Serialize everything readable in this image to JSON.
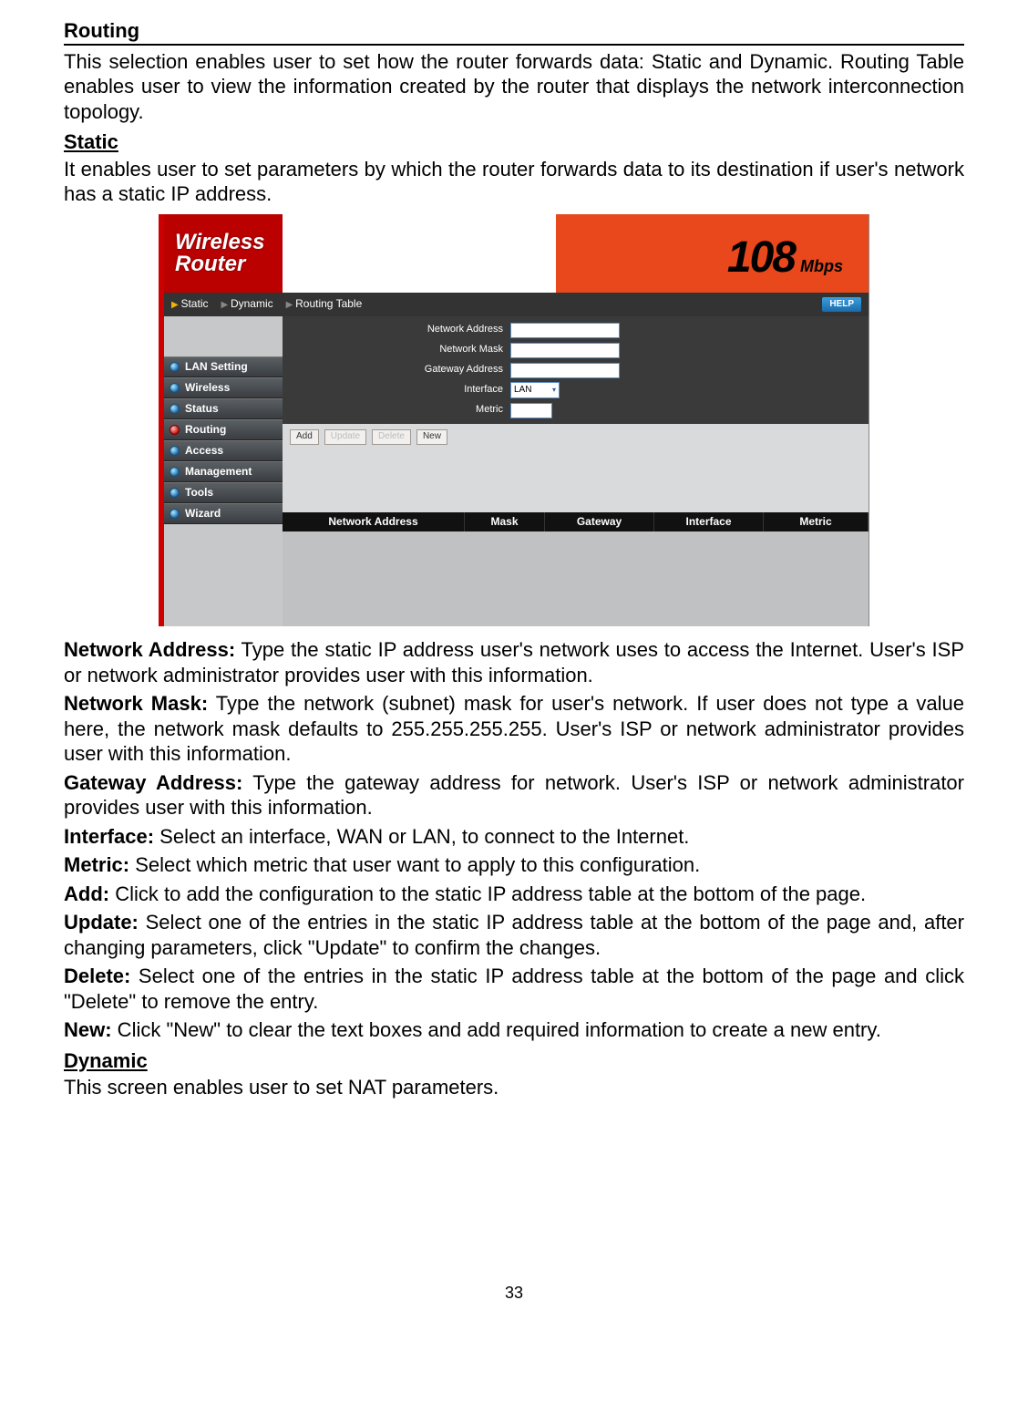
{
  "page_number": "33",
  "section": {
    "title": "Routing",
    "intro": "This selection enables user to set how the router forwards data: Static and Dynamic. Routing Table enables user to view the information created by the router that displays the network interconnection topology.",
    "static_title": "Static",
    "static_intro": "It enables user to set parameters by which the router forwards data to its destination if user's network has a static IP address.",
    "dynamic_title": "Dynamic",
    "dynamic_intro": "This screen enables user to set NAT parameters."
  },
  "router_ui": {
    "logo_line1": "Wireless",
    "logo_line2": "Router",
    "speed_number": "108",
    "speed_unit": "Mbps",
    "help_label": "HELP",
    "tabs": [
      "Static",
      "Dynamic",
      "Routing Table"
    ],
    "sidebar": [
      {
        "label": "LAN Setting",
        "active": false
      },
      {
        "label": "Wireless",
        "active": false
      },
      {
        "label": "Status",
        "active": false
      },
      {
        "label": "Routing",
        "active": true
      },
      {
        "label": "Access",
        "active": false
      },
      {
        "label": "Management",
        "active": false
      },
      {
        "label": "Tools",
        "active": false
      },
      {
        "label": "Wizard",
        "active": false
      }
    ],
    "form": {
      "network_address_label": "Network Address",
      "network_mask_label": "Network Mask",
      "gateway_address_label": "Gateway Address",
      "interface_label": "Interface",
      "interface_value": "LAN",
      "metric_label": "Metric"
    },
    "buttons": {
      "add": "Add",
      "update": "Update",
      "delete": "Delete",
      "new": "New"
    },
    "table_headers": [
      "Network Address",
      "Mask",
      "Gateway",
      "Interface",
      "Metric"
    ]
  },
  "descriptions": {
    "network_address_label": "Network Address:",
    "network_address_text": " Type the static IP address user's network uses to access the Internet. User's ISP or network administrator provides user with this information.",
    "network_mask_label": "Network Mask:",
    "network_mask_text": " Type the network (subnet) mask for user's network. If user does not type a value here, the network mask defaults to 255.255.255.255. User's ISP or network administrator provides user with this information.",
    "gateway_address_label": "Gateway Address:",
    "gateway_address_text": " Type the gateway address for network. User's ISP or network administrator provides user with this information.",
    "interface_label": "Interface:",
    "interface_text": " Select an interface, WAN or LAN, to connect to the Internet.",
    "metric_label": "Metric:",
    "metric_text": " Select which metric that user want to apply to this configuration.",
    "add_label": "Add:",
    "add_text": " Click to add the configuration to the static IP address table at the bottom of the page.",
    "update_label": "Update:",
    "update_text": " Select one of the entries in the static IP address table at the bottom of the page and, after changing parameters, click \"Update\" to confirm the changes.",
    "delete_label": "Delete:",
    "delete_text": " Select one of the entries in the static IP address table at the bottom of the page and click \"Delete\" to remove the entry.",
    "new_label": "New:",
    "new_text": " Click \"New\" to clear the text boxes and add required information to create a new entry."
  }
}
